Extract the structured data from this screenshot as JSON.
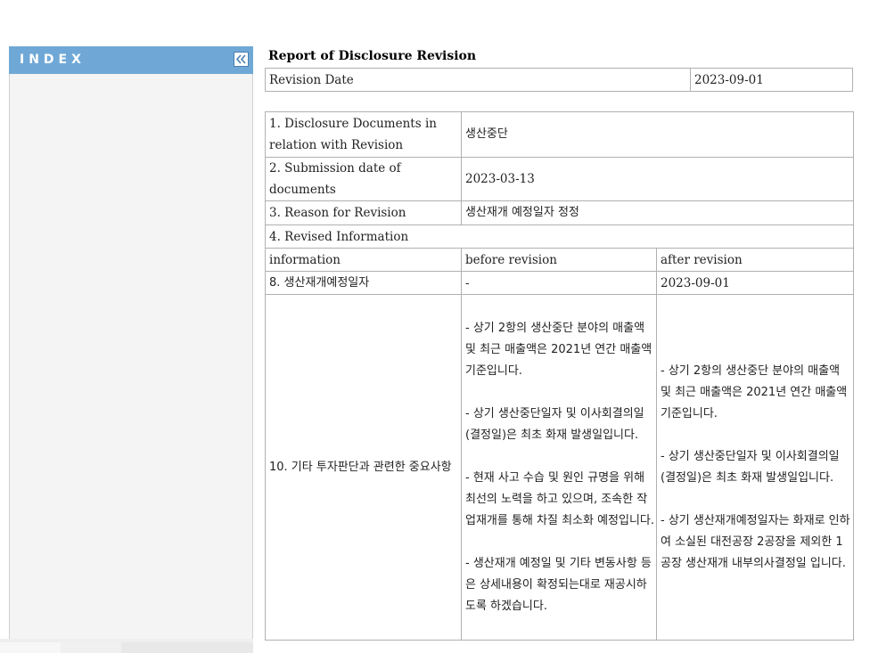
{
  "sidebar": {
    "title": "INDEX",
    "collapse_icon": "double-chevron-left-icon"
  },
  "report": {
    "title": "Report of Disclosure Revision",
    "revision_date_label": "Revision Date",
    "revision_date": "2023-09-01"
  },
  "details": {
    "docs_label": "1. Disclosure Documents in relation with Revision",
    "docs_value": "생산중단",
    "submission_label": "2. Submission date of documents",
    "submission_value": "2023-03-13",
    "reason_label": "3. Reason for Revision",
    "reason_value": "생산재개 예정일자 정정",
    "revised_label": "4. Revised Information",
    "headers": [
      "information",
      "before revision",
      "after revision"
    ],
    "rows": [
      {
        "info": "8. 생산재개예정일자",
        "before": "-",
        "after": "2023-09-01"
      },
      {
        "info": "10. 기타 투자판단과 관련한 중요사항",
        "before": "- 상기 2항의 생산중단 분야의 매출액 및 최근 매출액은 2021년 연간 매출액 기준입니다.\n\n- 상기 생산중단일자 및 이사회결의일(결정일)은 최초 화재 발생일입니다.\n\n- 현재 사고 수습 및 원인 규명을 위해 최선의 노력을 하고 있으며, 조속한 작업재개를 통해 차질 최소화 예정입니다.\n\n- 생산재개 예정일 및 기타 변동사항 등은 상세내용이 확정되는대로 재공시하도록 하겠습니다.",
        "after": "- 상기 2항의 생산중단 분야의 매출액 및 최근 매출액은 2021년 연간 매출액 기준입니다.\n\n- 상기 생산중단일자 및 이사회결의일(결정일)은 최초 화재 발생일입니다.\n\n- 상기 생산재개예정일자는 화재로 인하여 소실된 대전공장 2공장을 제외한 1공장 생산재개 내부의사결정일 입니다."
      }
    ]
  }
}
